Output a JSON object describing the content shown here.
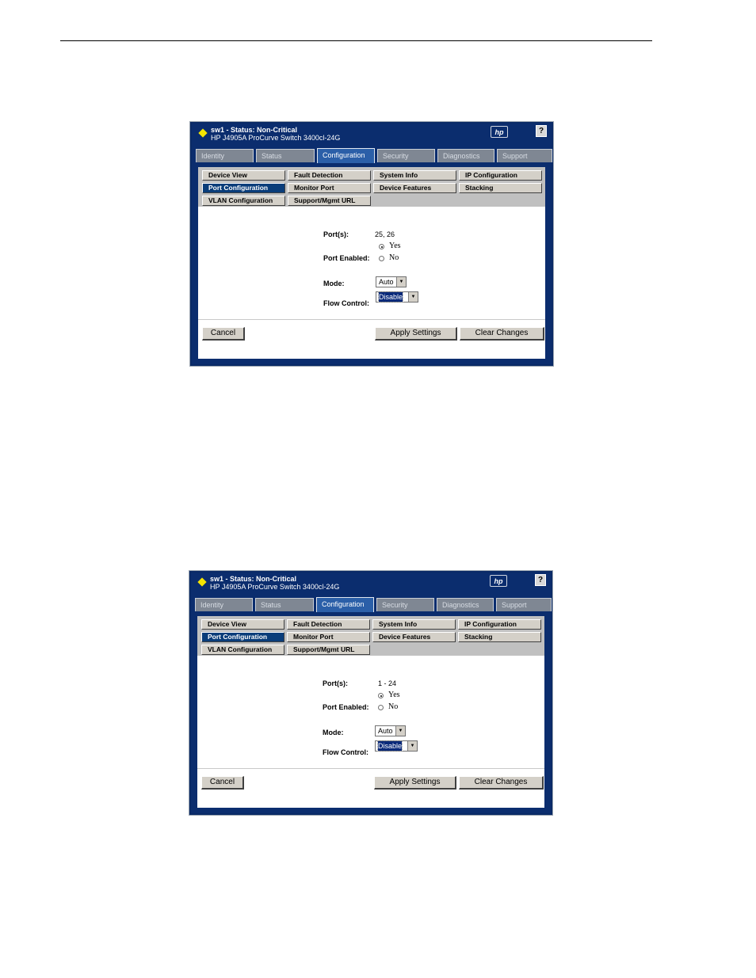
{
  "screens": [
    {
      "header": {
        "title": "sw1 - Status: Non-Critical",
        "subtitle": "HP J4905A ProCurve Switch 3400cl-24G",
        "logo_text": "hp",
        "help_label": "?"
      },
      "tabs": [
        "Identity",
        "Status",
        "Configuration",
        "Security",
        "Diagnostics",
        "Support"
      ],
      "active_tab": "Configuration",
      "subnav": [
        "Device View",
        "Fault Detection",
        "System Info",
        "IP Configuration",
        "Port Configuration",
        "Monitor Port",
        "Device Features",
        "Stacking",
        "VLAN Configuration",
        "Support/Mgmt URL"
      ],
      "active_subnav": "Port Configuration",
      "form": {
        "ports_label": "Port(s):",
        "ports_value": "25, 26",
        "port_enabled_label": "Port Enabled:",
        "yes_label": "Yes",
        "no_label": "No",
        "mode_label": "Mode:",
        "mode_value": "Auto",
        "flow_control_label": "Flow Control:",
        "flow_control_value": "Disable"
      },
      "buttons": {
        "cancel": "Cancel",
        "apply": "Apply Settings",
        "clear": "Clear Changes"
      }
    },
    {
      "header": {
        "title": "sw1 - Status: Non-Critical",
        "subtitle": "HP J4905A ProCurve Switch 3400cl-24G",
        "logo_text": "hp",
        "help_label": "?"
      },
      "tabs": [
        "Identity",
        "Status",
        "Configuration",
        "Security",
        "Diagnostics",
        "Support"
      ],
      "active_tab": "Configuration",
      "subnav": [
        "Device View",
        "Fault Detection",
        "System Info",
        "IP Configuration",
        "Port Configuration",
        "Monitor Port",
        "Device Features",
        "Stacking",
        "VLAN Configuration",
        "Support/Mgmt URL"
      ],
      "active_subnav": "Port Configuration",
      "form": {
        "ports_label": "Port(s):",
        "ports_value": "1 - 24",
        "port_enabled_label": "Port Enabled:",
        "yes_label": "Yes",
        "no_label": "No",
        "mode_label": "Mode:",
        "mode_value": "Auto",
        "flow_control_label": "Flow Control:",
        "flow_control_value": "Disable"
      },
      "buttons": {
        "cancel": "Cancel",
        "apply": "Apply Settings",
        "clear": "Clear Changes"
      }
    }
  ]
}
